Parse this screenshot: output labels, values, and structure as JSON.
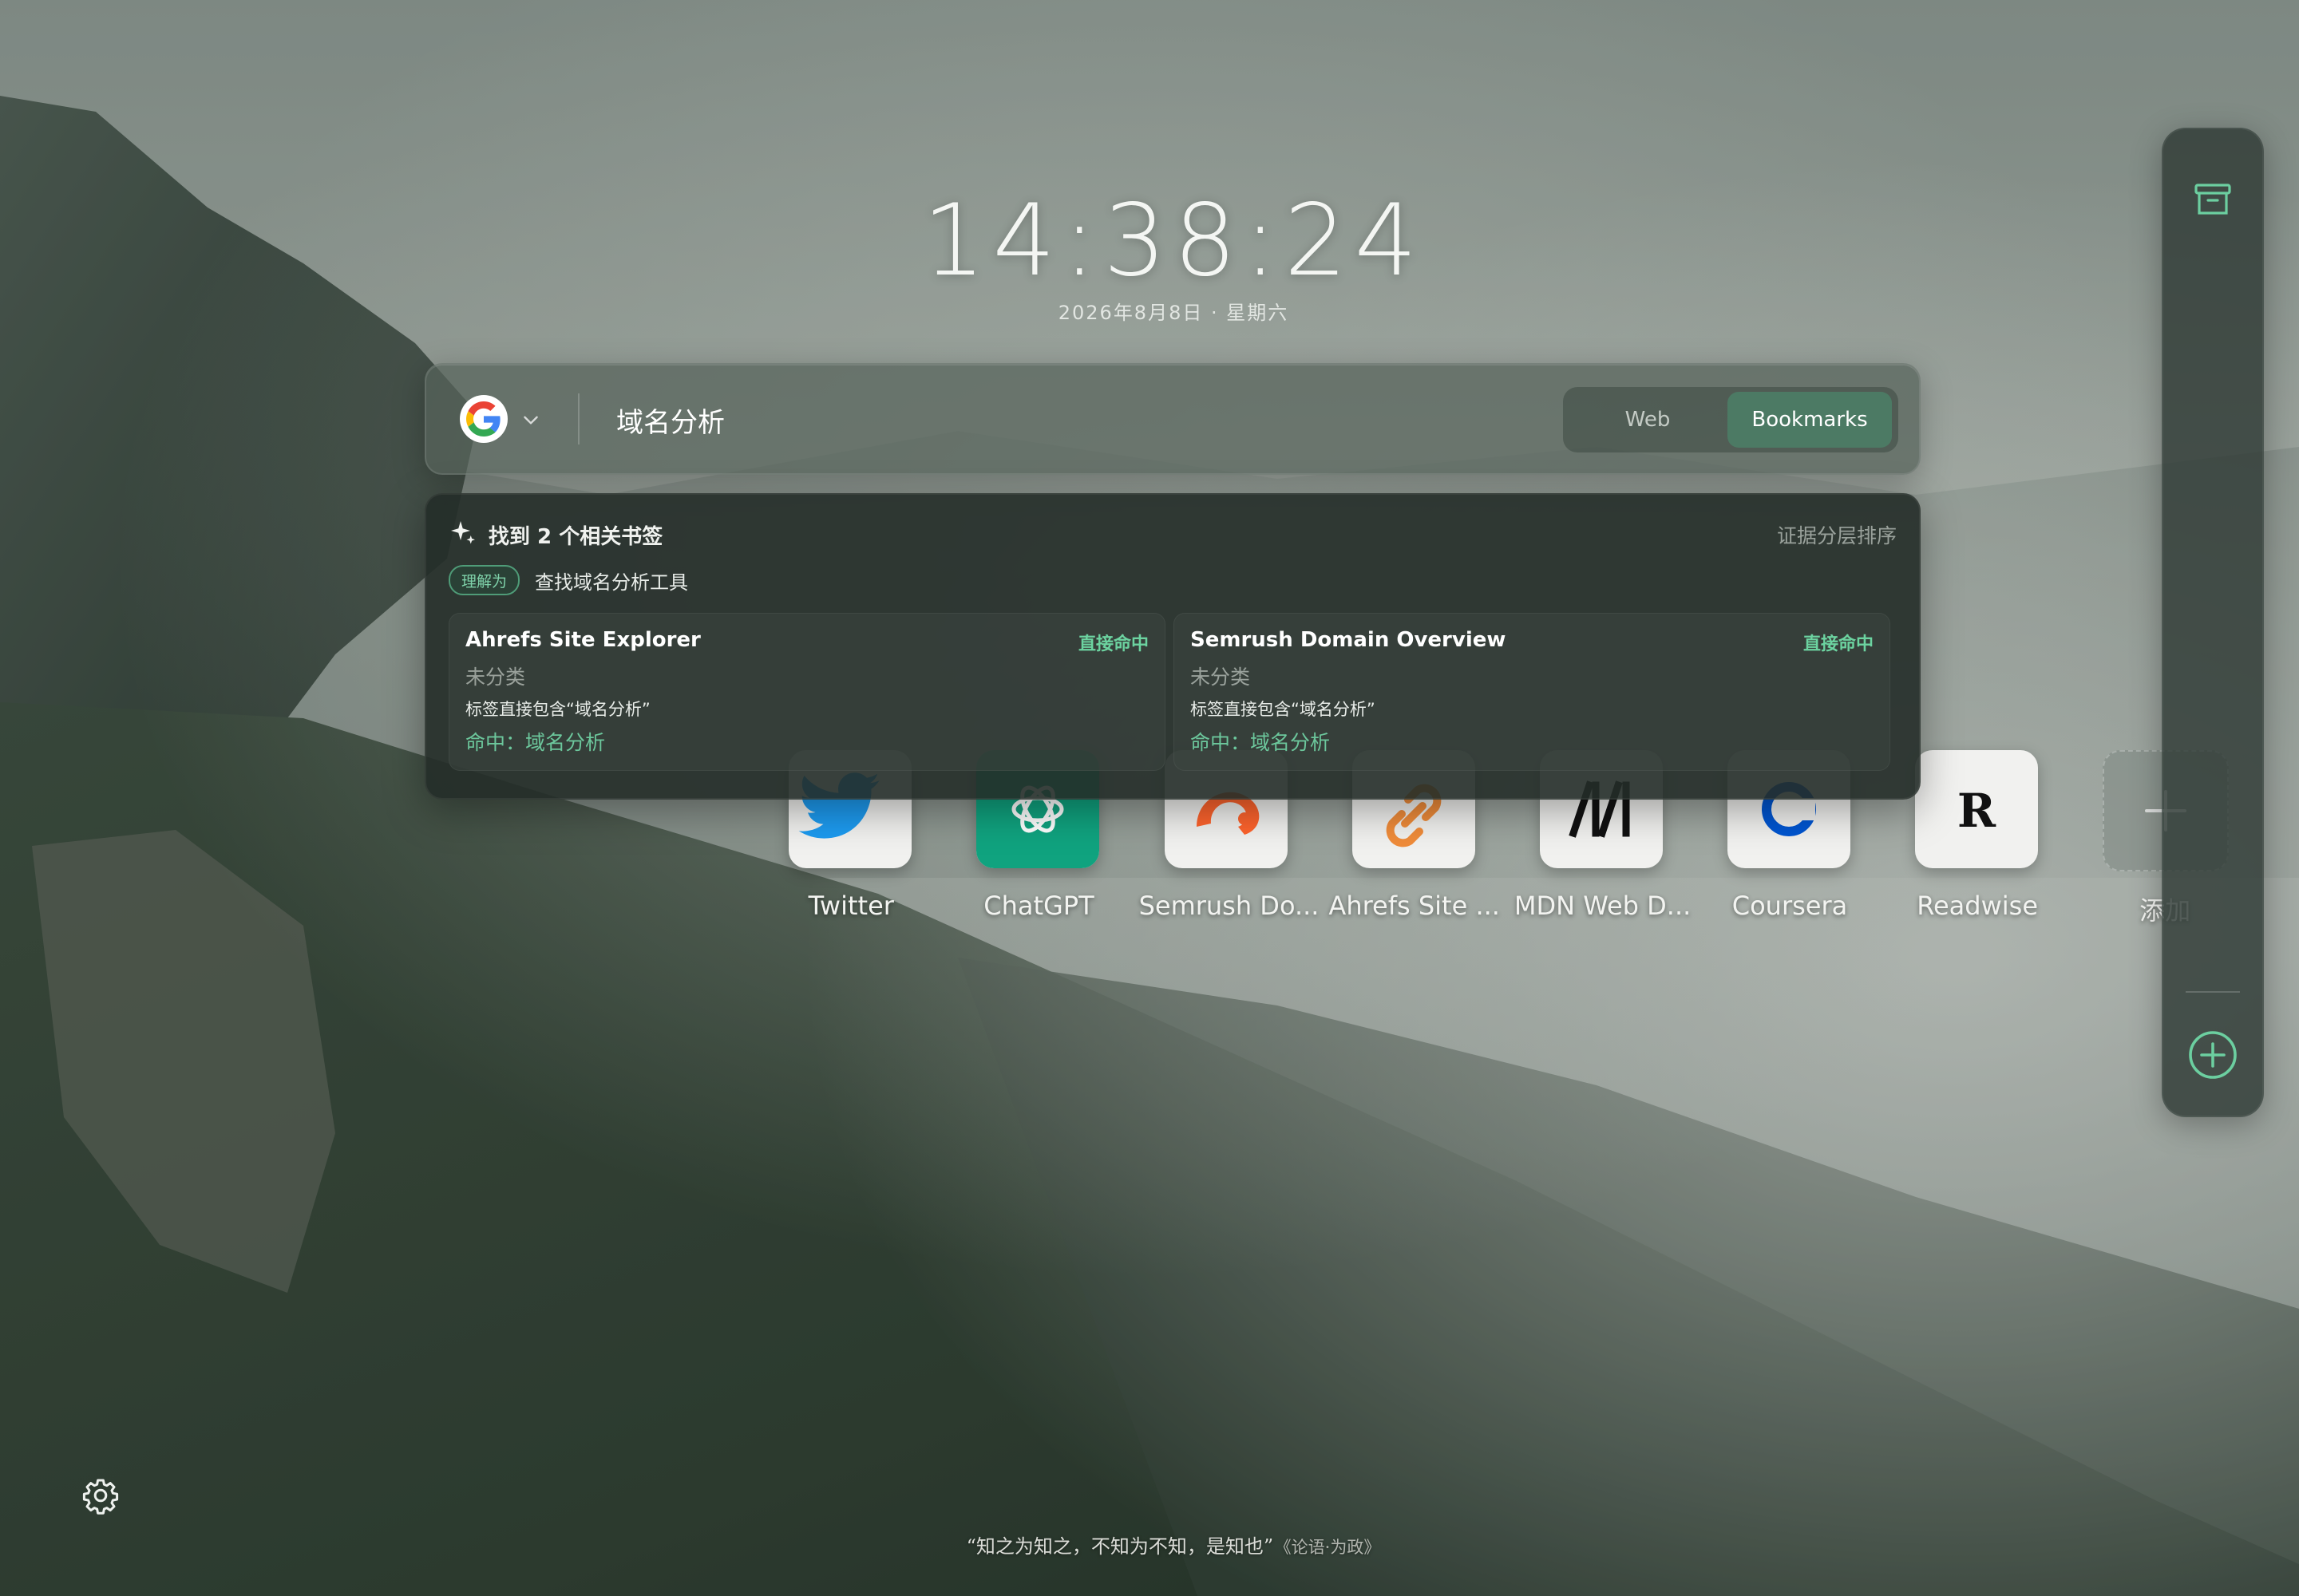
{
  "clock": {
    "time": "14:38:24",
    "date": "2026年8月8日 · 星期六"
  },
  "search": {
    "engine": "Google",
    "query": "域名分析",
    "modes": {
      "web": "Web",
      "bookmarks": "Bookmarks",
      "active": "bookmarks"
    }
  },
  "results": {
    "heading": "找到 2 个相关书签",
    "sort_label": "证据分层排序",
    "understood_badge": "理解为",
    "understood_text": "查找域名分析工具",
    "items": [
      {
        "title": "Ahrefs Site Explorer",
        "match_type": "直接命中",
        "category": "未分类",
        "reason": "标签直接包含“域名分析”",
        "hit": "命中：域名分析"
      },
      {
        "title": "Semrush Domain Overview",
        "match_type": "直接命中",
        "category": "未分类",
        "reason": "标签直接包含“域名分析”",
        "hit": "命中：域名分析"
      }
    ]
  },
  "shortcuts": [
    {
      "label": "Twitter",
      "icon": "twitter-bird-icon",
      "color": "#1d9bf0"
    },
    {
      "label": "ChatGPT",
      "icon": "openai-logo-icon",
      "color": "#10a37f"
    },
    {
      "label": "Semrush Do...",
      "icon": "semrush-logo-icon",
      "color": "#ff642d"
    },
    {
      "label": "Ahrefs Site ...",
      "icon": "link-icon",
      "color": "#f08c3a"
    },
    {
      "label": "MDN Web D...",
      "icon": "mdn-logo-icon",
      "color": "#111111"
    },
    {
      "label": "Coursera",
      "icon": "coursera-logo-icon",
      "color": "#0056d2"
    },
    {
      "label": "Readwise",
      "icon": "readwise-logo-icon",
      "color": "#111111"
    },
    {
      "label": "添加",
      "icon": "plus-icon",
      "color": "#ffffff"
    }
  ],
  "footer": {
    "quote": "“知之为知之，不知为不知，是知也”",
    "source": "《论语·为政》"
  },
  "colors": {
    "accent": "#4c7a64",
    "match": "#6cd3a0",
    "panel": "#242c28"
  }
}
